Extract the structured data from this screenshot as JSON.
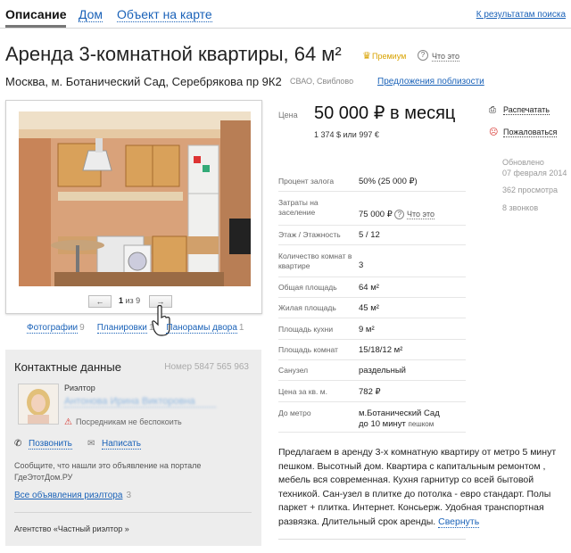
{
  "tabs": {
    "description": "Описание",
    "house": "Дом",
    "map": "Объект на карте",
    "back": "К результатам поиска"
  },
  "listing": {
    "title": "Аренда 3-комнатной квартиры, 64 м²",
    "premium": "Премиум",
    "what_this": "Что это",
    "address": "Москва, м. Ботанический Сад, Серебрякова пр 9К2",
    "district": "СВАО, Свиблово",
    "offers_nearby": "Предложения поблизости"
  },
  "gallery": {
    "current": "1",
    "of_text": "из 9",
    "prev": "←",
    "next": "→",
    "links": [
      {
        "label": "Фотографии",
        "count": "9"
      },
      {
        "label": "Планировки",
        "count": "1"
      },
      {
        "label": "Панорамы двора",
        "count": "1"
      }
    ]
  },
  "contact": {
    "heading": "Контактные данные",
    "number": "Номер 5847 565 963",
    "role": "Риэлтор",
    "name": "Антонова Ирина Викторовна",
    "no_disturb": "Посредникам не беспокоить",
    "call": "Позвонить",
    "write": "Написать",
    "note": "Сообщите, что нашли это объявление на портале ГдеЭтотДом.РУ",
    "all_ads": "Все объявления риэлтора",
    "all_ads_count": "3",
    "agency": "Агентство «Частный риэлтор »"
  },
  "price": {
    "label": "Цена",
    "value": "50 000 ₽ в месяц",
    "alt": "1 374 $ или 997 €"
  },
  "actions": {
    "print": "Распечатать",
    "complain": "Пожаловаться"
  },
  "stats": {
    "updated_label": "Обновлено",
    "updated_date": "07 февраля 2014",
    "views": "362 просмотра",
    "calls": "8 звонков"
  },
  "details": [
    {
      "label": "Процент залога",
      "value": "50% (25 000 ₽)"
    },
    {
      "label": "Затраты на заселение",
      "value": "75 000 ₽",
      "extra": "Что это"
    },
    {
      "label": "Этаж / Этажность",
      "value": "5 / 12"
    },
    {
      "label": "Количество комнат в квартире",
      "value": "3"
    },
    {
      "label": "Общая площадь",
      "value": "64 м²"
    },
    {
      "label": "Жилая площадь",
      "value": "45 м²"
    },
    {
      "label": "Площадь кухни",
      "value": "9 м²"
    },
    {
      "label": "Площадь комнат",
      "value": "15/18/12 м²"
    },
    {
      "label": "Санузел",
      "value": "раздельный"
    },
    {
      "label": "Цена за кв. м.",
      "value": "782 ₽"
    },
    {
      "label": "До метро",
      "value": "м.Ботанический Сад",
      "value2": "до 10 минут",
      "value2_suffix": "пешком"
    }
  ],
  "description": {
    "text": "Предлагаем в аренду 3-х комнатную квартиру от метро 5 минут пешком. Высотный дом. Квартира с капитальным ремонтом , мебель вся современная. Кухня гарнитур со всей бытовой техникой. Сан-узел в плитке до потолка - евро стандарт. Полы паркет + плитка. Интернет. Консьерж. Удобная транспортная развязка. Длительный срок аренды.",
    "collapse": "Свернуть"
  }
}
